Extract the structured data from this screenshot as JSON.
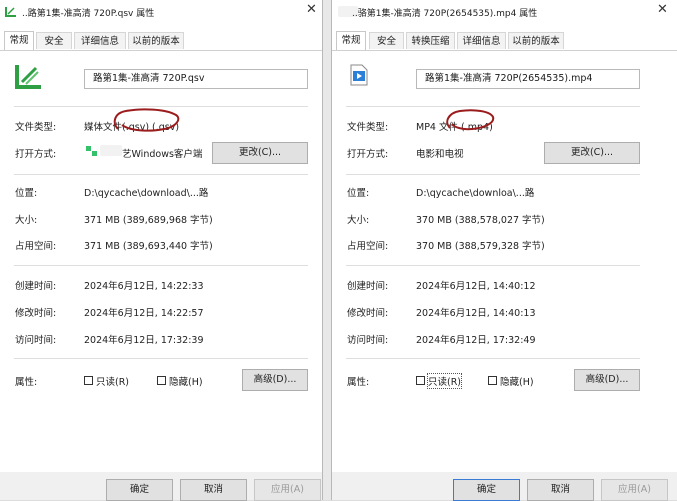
{
  "colors": {
    "annotation": "#9b1c1c",
    "primary_border": "#3a7bd5",
    "qsv_icon": "#2ea043",
    "mp4_icon": "#2b7fd8"
  },
  "left": {
    "title": "..路第1集-准高清 720P.qsv 属性",
    "tabs": [
      "常规",
      "安全",
      "详细信息",
      "以前的版本"
    ],
    "filename": "路第1集-准高清 720P.qsv",
    "file_type_label": "文件类型:",
    "file_type_value": "媒体文件(.qsv) (.qsv)",
    "open_with_label": "打开方式:",
    "open_with_value": "艺Windows客户端",
    "change_button": "更改(C)...",
    "location_label": "位置:",
    "location_value": "D:\\qycache\\download\\...路",
    "size_label": "大小:",
    "size_value": "371 MB (389,689,968 字节)",
    "size_on_disk_label": "占用空间:",
    "size_on_disk_value": "371 MB (389,693,440 字节)",
    "created_label": "创建时间:",
    "created_value": "2024年6月12日, 14:22:33",
    "modified_label": "修改时间:",
    "modified_value": "2024年6月12日, 14:22:57",
    "accessed_label": "访问时间:",
    "accessed_value": "2024年6月12日, 17:32:39",
    "attributes_label": "属性:",
    "readonly_label": "只读(R)",
    "hidden_label": "隐藏(H)",
    "advanced_button": "高级(D)...",
    "ok_button": "确定",
    "cancel_button": "取消",
    "apply_button": "应用(A)"
  },
  "right": {
    "title": "..骆第1集-准高清 720P(2654535).mp4 属性",
    "tabs": [
      "常规",
      "安全",
      "转换压缩",
      "详细信息",
      "以前的版本"
    ],
    "filename": "路第1集-准高清 720P(2654535).mp4",
    "file_type_label": "文件类型:",
    "file_type_value": "MP4 文件 (.mp4)",
    "open_with_label": "打开方式:",
    "open_with_value": "电影和电视",
    "change_button": "更改(C)...",
    "location_label": "位置:",
    "location_value": "D:\\qycache\\downloa\\...路",
    "size_label": "大小:",
    "size_value": "370 MB (388,578,027 字节)",
    "size_on_disk_label": "占用空间:",
    "size_on_disk_value": "370 MB (388,579,328 字节)",
    "created_label": "创建时间:",
    "created_value": "2024年6月12日, 14:40:12",
    "modified_label": "修改时间:",
    "modified_value": "2024年6月12日, 14:40:13",
    "accessed_label": "访问时间:",
    "accessed_value": "2024年6月12日, 17:32:49",
    "attributes_label": "属性:",
    "readonly_label": "只读(R)",
    "hidden_label": "隐藏(H)",
    "advanced_button": "高级(D)...",
    "ok_button": "确定",
    "cancel_button": "取消",
    "apply_button": "应用(A)"
  }
}
